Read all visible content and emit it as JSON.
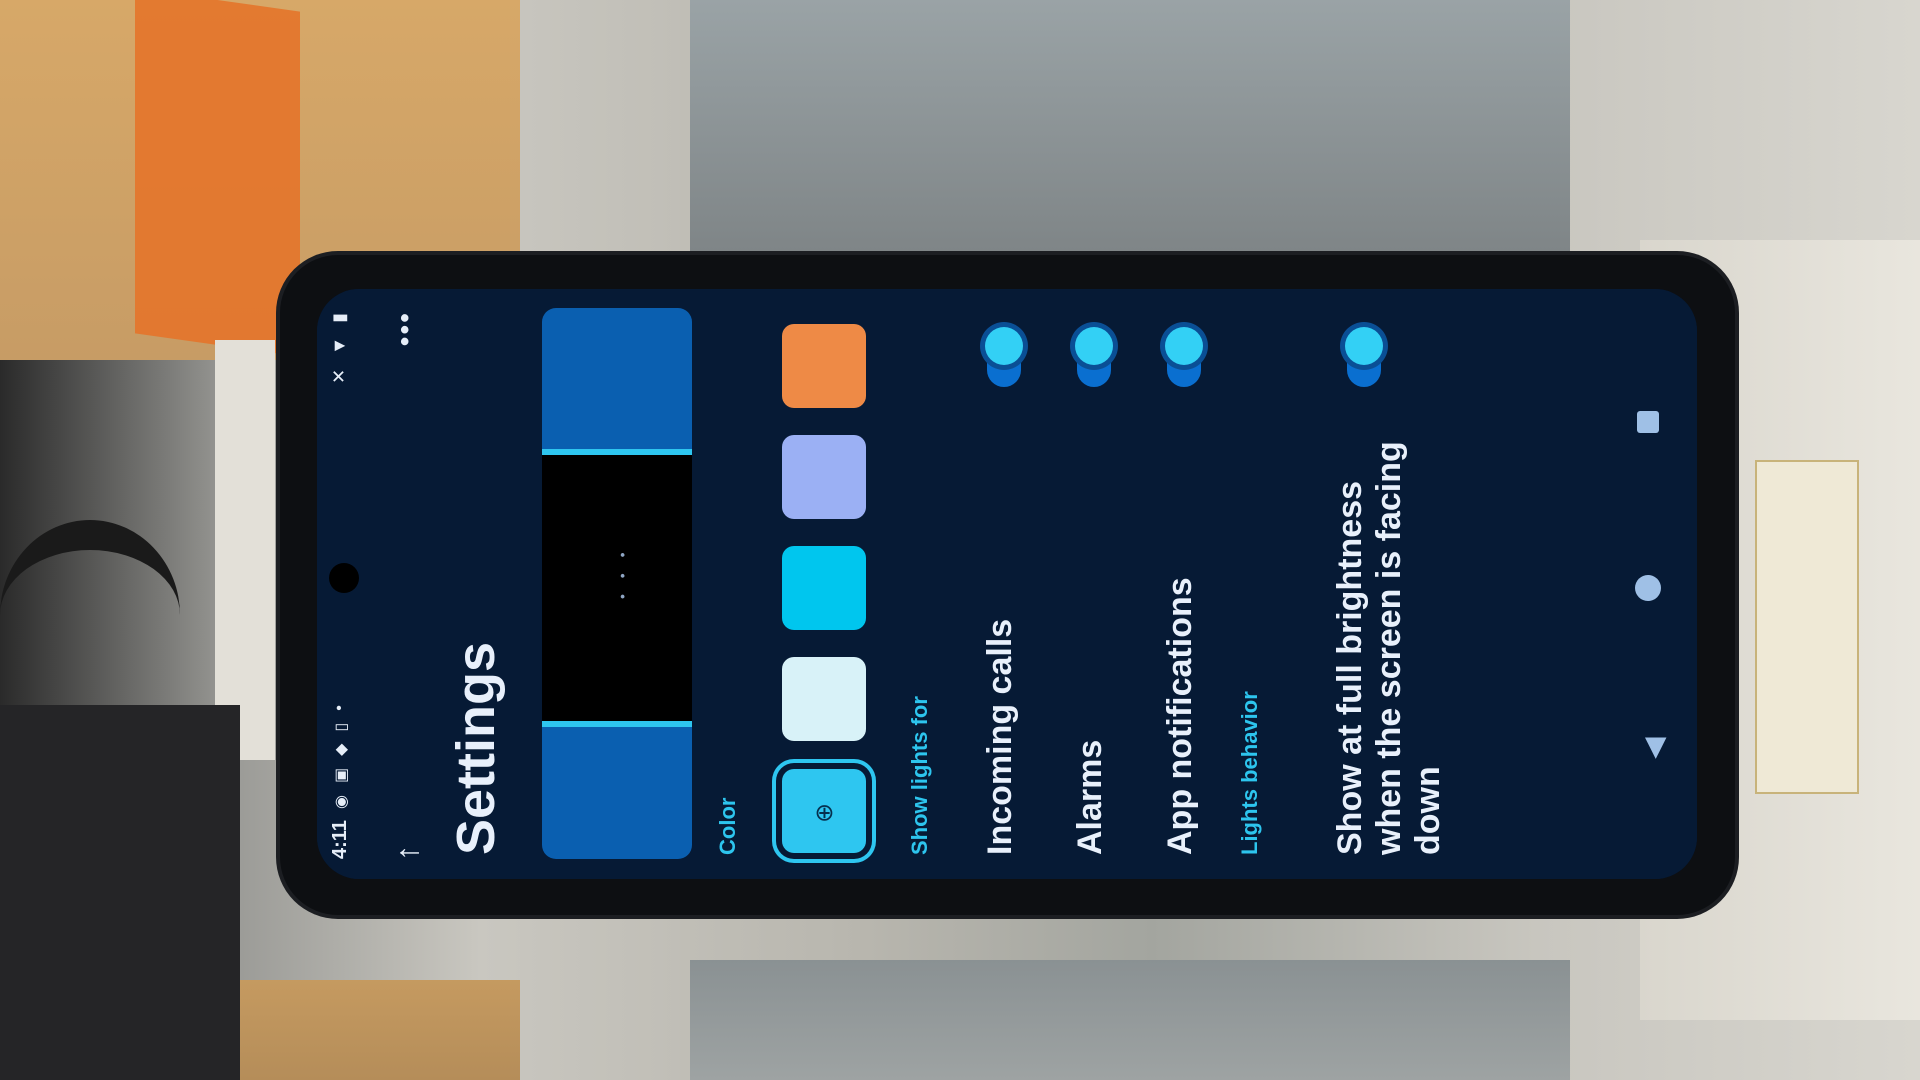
{
  "status_bar": {
    "time": "4:11",
    "icons": [
      "circle-icon",
      "image-icon",
      "shield-icon",
      "lock-icon"
    ],
    "system_icons": [
      "silent-icon",
      "wifi-icon",
      "battery-icon"
    ]
  },
  "header": {
    "back_icon": "↑",
    "title": "Settings",
    "more_icon": "•••"
  },
  "preview": {
    "dots": "• • •"
  },
  "color_section": {
    "label": "Color",
    "swatches": [
      {
        "name": "cyan-light",
        "color": "#2ec6f0",
        "selected": true
      },
      {
        "name": "white",
        "color": "#d8f2f8",
        "selected": false
      },
      {
        "name": "cyan",
        "color": "#00c6ee",
        "selected": false
      },
      {
        "name": "lavender",
        "color": "#9bb0f4",
        "selected": false
      },
      {
        "name": "orange",
        "color": "#ee8a46",
        "selected": false
      }
    ]
  },
  "show_lights_for": {
    "label": "Show lights for",
    "items": [
      {
        "label": "Incoming calls",
        "on": true
      },
      {
        "label": "Alarms",
        "on": true
      },
      {
        "label": "App notifications",
        "on": true
      }
    ]
  },
  "lights_behavior": {
    "label": "Lights behavior",
    "items": [
      {
        "label": "Show at full brightness when the screen is facing down",
        "on": true
      }
    ]
  },
  "nav": {
    "back": "◀"
  }
}
